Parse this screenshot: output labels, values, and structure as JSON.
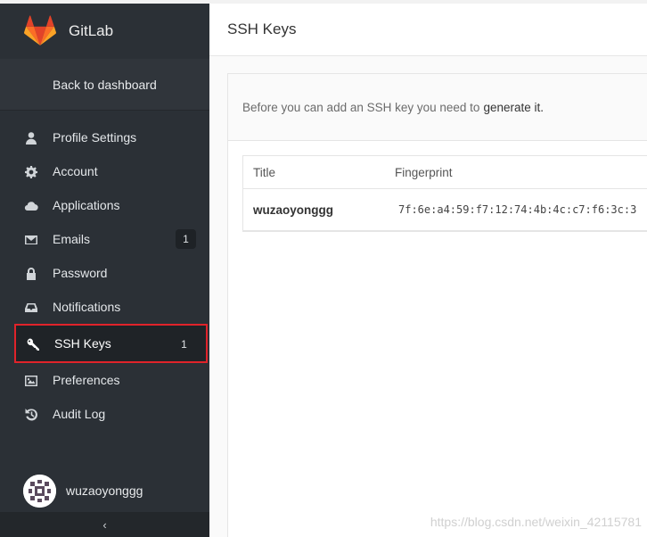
{
  "brand": {
    "name": "GitLab",
    "logo_icon": "gitlab-fox-icon",
    "colors": [
      "#e24329",
      "#fc6d26",
      "#fca326"
    ]
  },
  "sidebar": {
    "back_label": "Back to dashboard",
    "items": [
      {
        "label": "Profile Settings",
        "icon": "user-icon",
        "badge": ""
      },
      {
        "label": "Account",
        "icon": "gear-icon",
        "badge": ""
      },
      {
        "label": "Applications",
        "icon": "cloud-icon",
        "badge": ""
      },
      {
        "label": "Emails",
        "icon": "envelope-icon",
        "badge": "1"
      },
      {
        "label": "Password",
        "icon": "lock-icon",
        "badge": ""
      },
      {
        "label": "Notifications",
        "icon": "inbox-icon",
        "badge": ""
      },
      {
        "label": "SSH Keys",
        "icon": "key-icon",
        "badge": "1",
        "active": true
      },
      {
        "label": "Preferences",
        "icon": "image-icon",
        "badge": ""
      },
      {
        "label": "Audit Log",
        "icon": "history-icon",
        "badge": ""
      }
    ],
    "user": {
      "name": "wuzaoyonggg"
    },
    "collapse_glyph": "‹",
    "highlight_color": "#e0232a"
  },
  "header": {
    "title": "SSH Keys"
  },
  "notice": {
    "text": "Before you can add an SSH key you need to",
    "link": "generate it."
  },
  "keys_table": {
    "columns": [
      "Title",
      "Fingerprint"
    ],
    "rows": [
      {
        "title": "wuzaoyonggg",
        "fingerprint": "7f:6e:a4:59:f7:12:74:4b:4c:c7:f6:3c:3"
      }
    ]
  },
  "watermark": "https://blog.csdn.net/weixin_42115781"
}
